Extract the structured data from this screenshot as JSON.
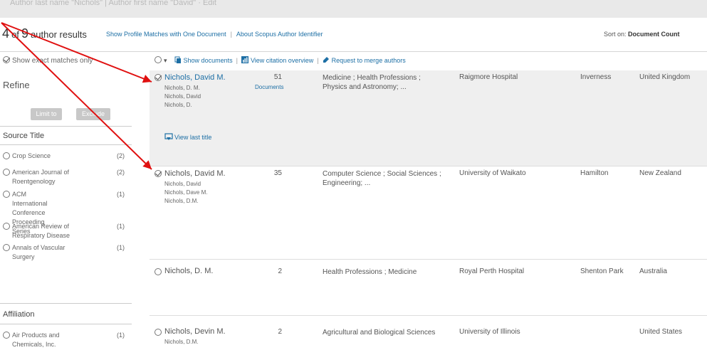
{
  "topbar": {
    "faded_text": "Author last name \"Nichols\" | Author first name \"David\"  ·  Edit"
  },
  "header": {
    "count_num": "4",
    "count_of": "of",
    "count_total": "9",
    "count_label": "author results",
    "link_one_doc": "Show Profile Matches with One Document",
    "link_about": "About Scopus Author Identifier",
    "sort_label": "Sort on:",
    "sort_value": "Document Count"
  },
  "sidebar": {
    "exact_label": "Show exact matches only",
    "refine_title": "Refine",
    "limit_btn": "Limit to",
    "exclude_btn": "Exclude",
    "source_title": "Source Title",
    "source_items": [
      {
        "label": "Crop Science",
        "count": "(2)"
      },
      {
        "label": "American Journal of Roentgenology",
        "count": "(2)"
      },
      {
        "label": "ACM International Conference Proceeding Series",
        "count": "(1)"
      },
      {
        "label": "American Review of Respiratory Disease",
        "count": "(1)"
      },
      {
        "label": "Annals of Vascular Surgery",
        "count": "(1)"
      }
    ],
    "affiliation_title": "Affiliation",
    "affiliation_items": [
      {
        "label": "Air Products and Chemicals, Inc.",
        "count": "(1)"
      }
    ]
  },
  "toolbar": {
    "show_documents": "Show documents",
    "view_citation": "View citation overview",
    "request_merge": "Request to merge authors"
  },
  "results": [
    {
      "name": "Nichols, David M.",
      "aliases": [
        "Nichols, D. M.",
        "Nichols, David",
        "Nichols, D."
      ],
      "documents": "51",
      "documents_link": "Documents",
      "subjects": "Medicine ; Health Professions ; Physics and Astronomy; ...",
      "affiliation": "Raigmore Hospital",
      "city": "Inverness",
      "country": "United Kingdom",
      "view_last_title": "View last title",
      "checked": true
    },
    {
      "name": "Nichols, David M.",
      "aliases": [
        "Nichols, David",
        "Nichols, Dave M.",
        "Nichols, D.M."
      ],
      "documents": "35",
      "subjects": "Computer Science ; Social Sciences ; Engineering; ...",
      "affiliation": "University of Waikato",
      "city": "Hamilton",
      "country": "New Zealand",
      "checked": true
    },
    {
      "name": "Nichols, D. M.",
      "aliases": [],
      "documents": "2",
      "subjects": "Health Professions ; Medicine",
      "affiliation": "Royal Perth Hospital",
      "city": "Shenton Park",
      "country": "Australia",
      "checked": false
    },
    {
      "name": "Nichols, Devin M.",
      "aliases": [
        "Nichols, D.M."
      ],
      "documents": "2",
      "subjects": "Agricultural and Biological Sciences",
      "affiliation": "University of Illinois",
      "city": "",
      "country": "United States",
      "checked": false
    }
  ],
  "colors": {
    "link": "#1d6fa5",
    "arrow": "#e01010",
    "row_highlight": "#efefef"
  }
}
